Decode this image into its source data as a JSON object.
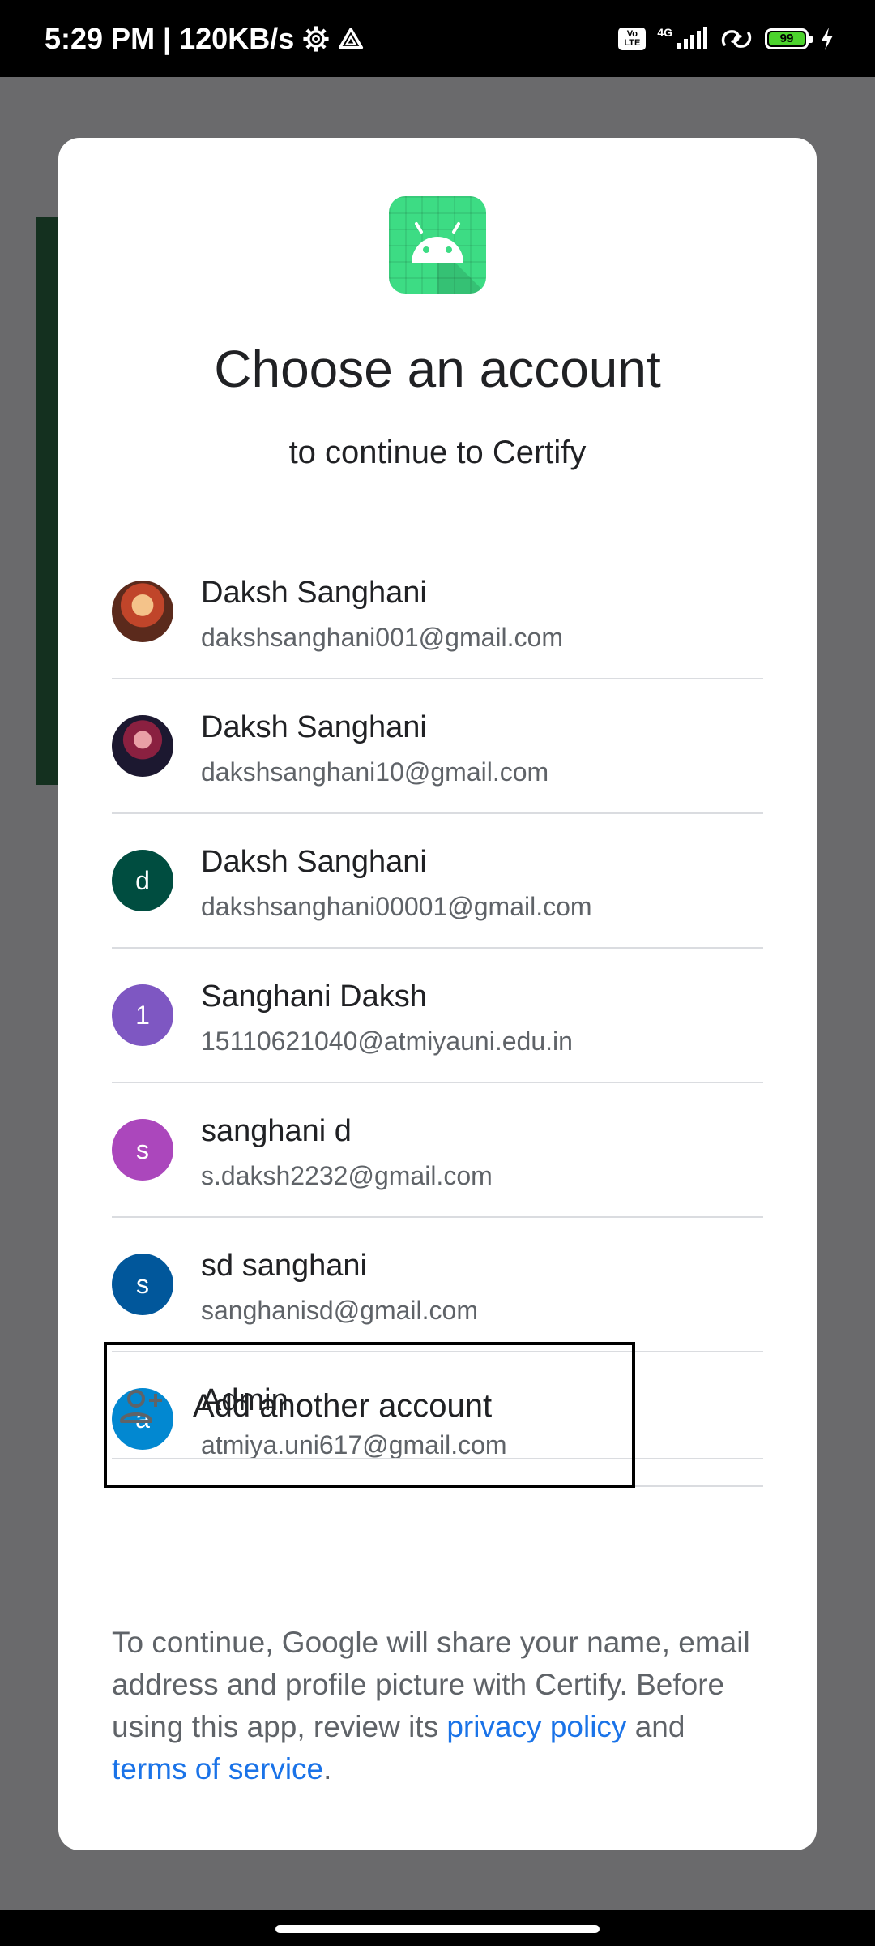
{
  "status_bar": {
    "time_speed": "5:29 PM | 120KB/s",
    "volte": "Vo LTE",
    "network": "4G",
    "battery": "99"
  },
  "dialog": {
    "title": "Choose an account",
    "subtitle": "to continue to Certify",
    "accounts": [
      {
        "name": "Daksh Sanghani",
        "email": "dakshsanghani001@gmail.com",
        "avatar_letter": "",
        "avatar_color": "#8a4a2c"
      },
      {
        "name": "Daksh Sanghani",
        "email": "dakshsanghani10@gmail.com",
        "avatar_letter": "",
        "avatar_color": "#3a1d2e"
      },
      {
        "name": "Daksh Sanghani",
        "email": "dakshsanghani00001@gmail.com",
        "avatar_letter": "d",
        "avatar_color": "#004d40"
      },
      {
        "name": "Sanghani Daksh",
        "email": "15110621040@atmiyauni.edu.in",
        "avatar_letter": "1",
        "avatar_color": "#7e57c2"
      },
      {
        "name": "sanghani d",
        "email": "s.daksh2232@gmail.com",
        "avatar_letter": "s",
        "avatar_color": "#ab47bc"
      },
      {
        "name": "sd sanghani",
        "email": "sanghanisd@gmail.com",
        "avatar_letter": "s",
        "avatar_color": "#01579b"
      },
      {
        "name": "Admin",
        "email": "atmiya.uni617@gmail.com",
        "avatar_letter": "a",
        "avatar_color": "#0288d1"
      }
    ],
    "add_account_label": "Add another account",
    "disclaimer": {
      "text_before": "To continue, Google will share your name, email address and profile picture with Certify. Before using this app, review its ",
      "privacy_link": "privacy policy",
      "and_text": " and ",
      "terms_link": "terms of service",
      "end_text": "."
    }
  },
  "colors": {
    "link": "#1a73e8",
    "android_green": "#3ddc84"
  }
}
